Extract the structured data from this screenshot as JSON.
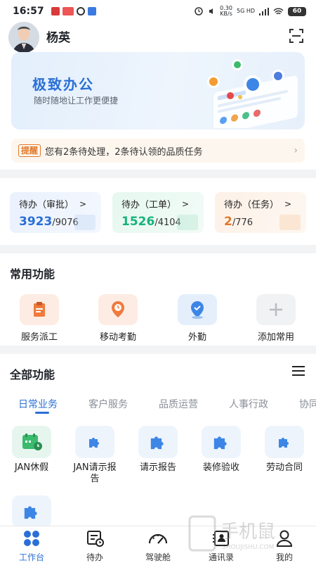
{
  "status_bar": {
    "time": "16:57",
    "network_speed": "0.30",
    "network_unit": "KB/s",
    "signal_label": "5G HD",
    "battery": "60"
  },
  "header": {
    "username": "杨英"
  },
  "banner": {
    "title": "极致办公",
    "subtitle": "随时随地让工作更便捷"
  },
  "reminder": {
    "tag": "提醒",
    "text": "您有2条待处理，2条待认领的品质任务"
  },
  "todos": [
    {
      "label": "待办（审批）",
      "arrow": ">",
      "count": "3923",
      "total": "/9076",
      "color": "#2a6fd6"
    },
    {
      "label": "待办（工单）",
      "arrow": ">",
      "count": "1526",
      "total": "/4104",
      "color": "#17b37b"
    },
    {
      "label": "待办（任务）",
      "arrow": ">",
      "count": "2",
      "total": "/776",
      "color": "#e1792c"
    }
  ],
  "common": {
    "title": "常用功能",
    "items": [
      {
        "label": "服务派工",
        "icon": "clipboard-icon"
      },
      {
        "label": "移动考勤",
        "icon": "location-clock-icon"
      },
      {
        "label": "外勤",
        "icon": "location-check-icon"
      },
      {
        "label": "添加常用",
        "icon": "plus-icon"
      }
    ]
  },
  "all_functions": {
    "title": "全部功能",
    "tabs": [
      "日常业务",
      "客户服务",
      "品质运营",
      "人事行政",
      "协同"
    ],
    "active_tab": 0,
    "apps": [
      {
        "label": "JAN休假",
        "icon": "calendar-icon"
      },
      {
        "label": "JAN请示报告",
        "icon": "puzzle-icon"
      },
      {
        "label": "请示报告",
        "icon": "puzzle-icon"
      },
      {
        "label": "装修验收",
        "icon": "puzzle-icon"
      },
      {
        "label": "劳动合同",
        "icon": "puzzle-icon"
      },
      {
        "label": "",
        "icon": "puzzle-icon"
      }
    ]
  },
  "bottom_nav": [
    {
      "label": "工作台",
      "icon": "grid-icon",
      "active": true
    },
    {
      "label": "待办",
      "icon": "todo-icon",
      "active": false
    },
    {
      "label": "驾驶舱",
      "icon": "speedometer-icon",
      "active": false
    },
    {
      "label": "通讯录",
      "icon": "contacts-icon",
      "active": false
    },
    {
      "label": "我的",
      "icon": "user-icon",
      "active": false
    }
  ],
  "watermark": {
    "text": "手机鼠",
    "sub": "SHOUJISHU.COM"
  },
  "colors": {
    "accent": "#2a6fd6",
    "green": "#17b37b",
    "orange": "#e1792c"
  }
}
